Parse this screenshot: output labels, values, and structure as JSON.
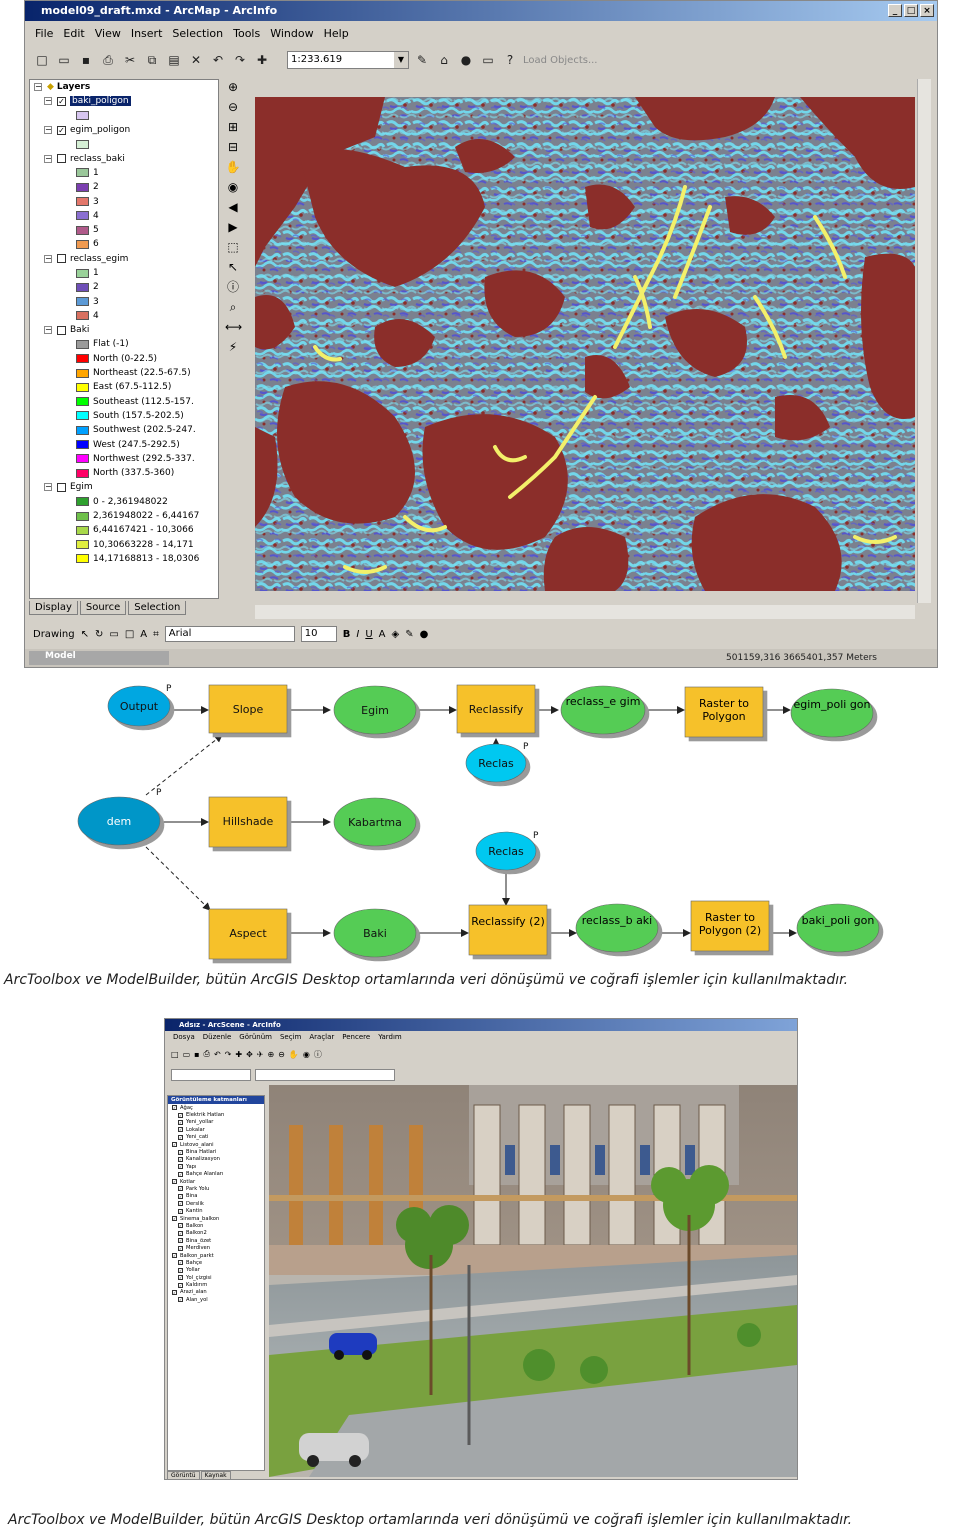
{
  "arcmap": {
    "title": "model09_draft.mxd - ArcMap - ArcInfo",
    "menu": [
      "File",
      "Edit",
      "View",
      "Insert",
      "Selection",
      "Tools",
      "Window",
      "Help"
    ],
    "scale": "1:233.619",
    "load_objects": "Load Objects...",
    "toc_tabs": [
      "Display",
      "Source",
      "Selection"
    ],
    "status_task": "Model",
    "status_coords": "501159,316  3665401,357 Meters",
    "font_name": "Arial",
    "font_size": "10",
    "drawing_label": "Drawing",
    "toc": [
      {
        "t": "group",
        "label": "Layers"
      },
      {
        "t": "layer",
        "label": "baki_poligon",
        "checked": true,
        "selected": true
      },
      {
        "t": "swatch",
        "color": "#d7c6f0",
        "label": ""
      },
      {
        "t": "layer",
        "label": "egim_poligon",
        "checked": true
      },
      {
        "t": "swatch",
        "color": "#d6f0d6",
        "label": ""
      },
      {
        "t": "layer",
        "label": "reclass_baki",
        "checked": false
      },
      {
        "t": "swatch",
        "color": "#9ac79a",
        "label": "1"
      },
      {
        "t": "swatch",
        "color": "#7b3fb0",
        "label": "2"
      },
      {
        "t": "swatch",
        "color": "#e3776b",
        "label": "3"
      },
      {
        "t": "swatch",
        "color": "#8a6fd1",
        "label": "4"
      },
      {
        "t": "swatch",
        "color": "#b05a8a",
        "label": "5"
      },
      {
        "t": "swatch",
        "color": "#f09a50",
        "label": "6"
      },
      {
        "t": "layer",
        "label": "reclass_egim",
        "checked": false
      },
      {
        "t": "swatch",
        "color": "#9ad29a",
        "label": "1"
      },
      {
        "t": "swatch",
        "color": "#6f4fb8",
        "label": "2"
      },
      {
        "t": "swatch",
        "color": "#5c9ad6",
        "label": "3"
      },
      {
        "t": "swatch",
        "color": "#d87060",
        "label": "4"
      },
      {
        "t": "layer",
        "label": "Baki",
        "checked": false
      },
      {
        "t": "swatch",
        "color": "#9a9a9a",
        "label": "Flat (-1)"
      },
      {
        "t": "swatch",
        "color": "#ff0000",
        "label": "North (0-22.5)"
      },
      {
        "t": "swatch",
        "color": "#ffa500",
        "label": "Northeast (22.5-67.5)"
      },
      {
        "t": "swatch",
        "color": "#ffff00",
        "label": "East (67.5-112.5)"
      },
      {
        "t": "swatch",
        "color": "#00ff00",
        "label": "Southeast (112.5-157."
      },
      {
        "t": "swatch",
        "color": "#00ffff",
        "label": "South (157.5-202.5)"
      },
      {
        "t": "swatch",
        "color": "#00a0ff",
        "label": "Southwest (202.5-247."
      },
      {
        "t": "swatch",
        "color": "#0000ff",
        "label": "West (247.5-292.5)"
      },
      {
        "t": "swatch",
        "color": "#ff00ff",
        "label": "Northwest (292.5-337."
      },
      {
        "t": "swatch",
        "color": "#ff0066",
        "label": "North (337.5-360)"
      },
      {
        "t": "layer",
        "label": "Egim",
        "checked": false
      },
      {
        "t": "swatch",
        "color": "#2ea02e",
        "label": "0 - 2,361948022"
      },
      {
        "t": "swatch",
        "color": "#6ec04a",
        "label": "2,361948022 - 6,44167"
      },
      {
        "t": "swatch",
        "color": "#a8d84a",
        "label": "6,44167421 - 10,3066"
      },
      {
        "t": "swatch",
        "color": "#e0ee40",
        "label": "10,30663228 - 14,171"
      },
      {
        "t": "swatch",
        "color": "#ffff00",
        "label": "14,17168813 - 18,0306"
      }
    ],
    "colors": {
      "brown": "#8b2e2a",
      "cyan": "#6fd3e8",
      "slate": "#6f7faa",
      "purple": "#5a5ad0",
      "yellow": "#f3f06a"
    }
  },
  "modelbuilder": {
    "nodes": {
      "output": "Output",
      "slope": "Slope",
      "egim": "Egim",
      "reclassify": "Reclassify",
      "reclass_egim": "reclass_e gim",
      "raster_to_polygon": "Raster to Polygon",
      "egim_poligon": "egim_poli gon",
      "reclas1": "Reclas",
      "dem": "dem",
      "hillshade": "Hillshade",
      "kabartma": "Kabartma",
      "reclas2": "Reclas",
      "aspect": "Aspect",
      "baki": "Baki",
      "reclassify2": "Reclassify (2)",
      "reclass_baki": "reclass_b aki",
      "raster_to_polygon2": "Raster to Polygon (2)",
      "baki_poligon": "baki_poli gon"
    },
    "colors": {
      "input": "#00a7e1",
      "tool": "#f6c12c",
      "data": "#54cc54"
    }
  },
  "caption1": "ArcToolbox ve ModelBuilder,  bütün ArcGIS Desktop ortamlarında veri dönüşümü ve coğrafi işlemler için kullanılmaktadır.",
  "arcscene": {
    "title": "Adsız - ArcScene - ArcInfo",
    "menu": [
      "Dosya",
      "Düzenle",
      "Görünüm",
      "Seçim",
      "Araçlar",
      "Pencere",
      "Yardım"
    ],
    "toc_header": "Görüntüleme katmanları",
    "toc": [
      "Ağaç",
      "Elektrik Hatları",
      "Yeni_yollar",
      "Lokalar",
      "Yeni_cati",
      "Listovo_alani",
      "Bina Hatlari",
      "Kanalizasyon",
      "Yapı",
      "Bahçe Alanları",
      "Kotlar",
      "Park Yolu",
      "Bina",
      "Derslik",
      "Kantin",
      "Sinema_balkon",
      "Balkon",
      "Balkon2",
      "Bina_özet",
      "Merdiven",
      "Balkon_parkt",
      "Bahçe",
      "Yollar",
      "Yol_çizgisi",
      "Kaldırım",
      "Arazi_alan",
      "Alan_yol"
    ],
    "tabs": [
      "Görüntü",
      "Kaynak"
    ]
  },
  "caption2": "ArcToolbox ve ModelBuilder,  bütün ArcGIS Desktop ortamlarında veri dönüşümü ve coğrafi işlemler için kullanılmaktadır."
}
